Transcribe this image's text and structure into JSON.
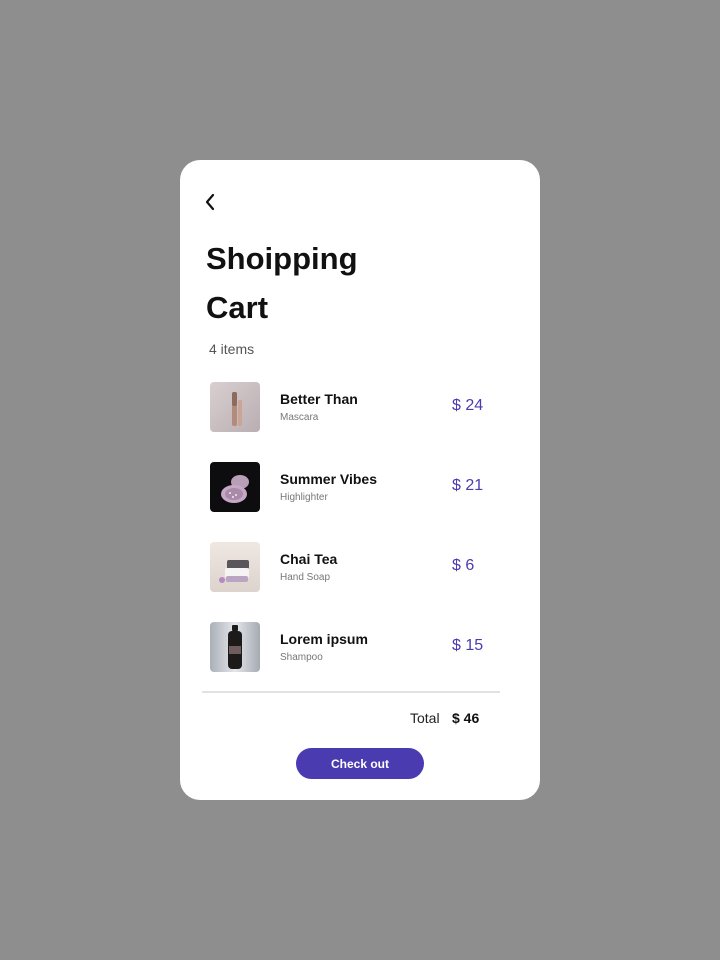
{
  "header": {
    "back_icon": "chevron-left-icon",
    "title": "Shoipping Cart",
    "item_count": "4 items"
  },
  "cart": {
    "items": [
      {
        "name": "Better Than",
        "type": "Mascara",
        "price": "$ 24",
        "thumbnail": "mascara-photo"
      },
      {
        "name": "Summer Vibes",
        "type": "Highlighter",
        "price": "$ 21",
        "thumbnail": "highlighter-photo"
      },
      {
        "name": "Chai Tea",
        "type": "Hand Soap",
        "price": "$ 6",
        "thumbnail": "soap-photo"
      },
      {
        "name": "Lorem ipsum",
        "type": "Shampoo",
        "price": "$ 15",
        "thumbnail": "shampoo-bottle-photo"
      }
    ]
  },
  "summary": {
    "total_label": "Total",
    "total_value": "$ 46"
  },
  "actions": {
    "checkout_label": "Check out"
  },
  "colors": {
    "background": "#8e8e8e",
    "card": "#ffffff",
    "accent": "#4a3bb0"
  }
}
